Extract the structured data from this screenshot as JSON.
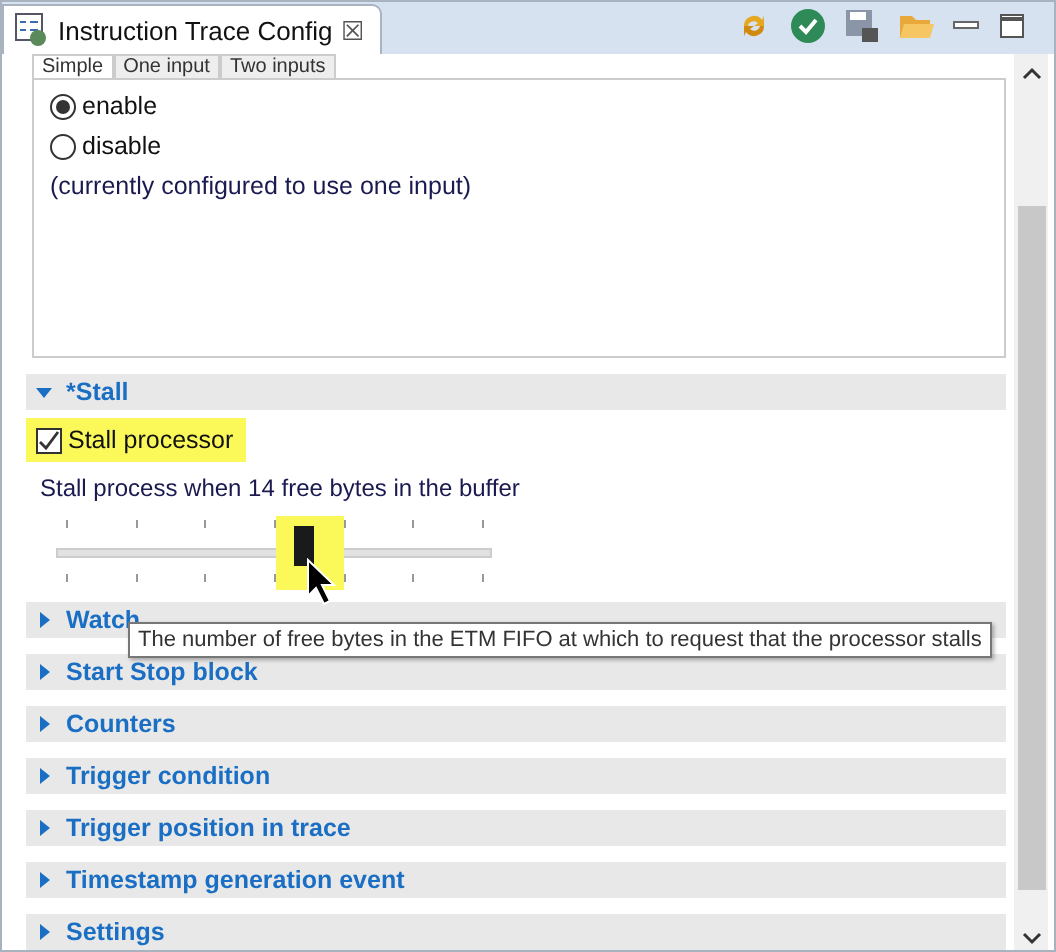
{
  "editor_tab": {
    "title": "Instruction Trace Config",
    "close": "☒"
  },
  "toolbar": [
    {
      "kind": "sync"
    },
    {
      "kind": "apply"
    },
    {
      "kind": "save"
    },
    {
      "kind": "open"
    },
    {
      "kind": "minimize"
    },
    {
      "kind": "maximize"
    }
  ],
  "input_tabs": [
    {
      "label": "Simple",
      "selected": true
    },
    {
      "label": "One input",
      "selected": false
    },
    {
      "label": "Two inputs",
      "selected": false
    }
  ],
  "radios": [
    {
      "label": "enable",
      "selected": true
    },
    {
      "label": "disable",
      "selected": false
    }
  ],
  "note": "(currently configured to use one input)",
  "sections": [
    {
      "title": "*Stall",
      "expanded": true,
      "checkbox": {
        "label": "Stall processor",
        "checked": true
      },
      "slider_label": "Stall process when 14 free bytes in the buffer",
      "slider": {
        "level": 0.57
      }
    },
    {
      "title": "Watch",
      "expanded": false
    },
    {
      "title": "Start Stop block",
      "expanded": false
    },
    {
      "title": "Counters",
      "expanded": false
    },
    {
      "title": "Trigger condition",
      "expanded": false
    },
    {
      "title": "Trigger position in trace",
      "expanded": false
    },
    {
      "title": "Timestamp generation event",
      "expanded": false
    },
    {
      "title": "Settings",
      "expanded": false
    }
  ],
  "tooltip": "The number of free bytes in the ETM FIFO at which to request that the processor stalls"
}
